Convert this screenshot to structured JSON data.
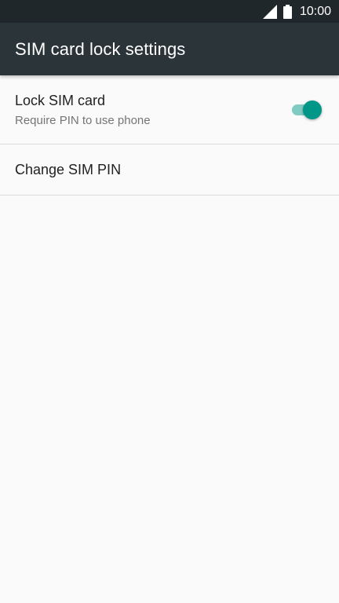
{
  "status_bar": {
    "time": "10:00",
    "icons": [
      "signal-icon",
      "battery-icon"
    ]
  },
  "app_bar": {
    "title": "SIM card lock settings"
  },
  "settings": {
    "lock_sim": {
      "title": "Lock SIM card",
      "summary": "Require PIN to use phone",
      "toggle_on": true
    },
    "change_pin": {
      "title": "Change SIM PIN"
    }
  },
  "colors": {
    "status_bar": "#20272a",
    "app_bar": "#2b3539",
    "accent": "#009688",
    "accent_track": "#80cbc4",
    "background": "#fafafa"
  }
}
